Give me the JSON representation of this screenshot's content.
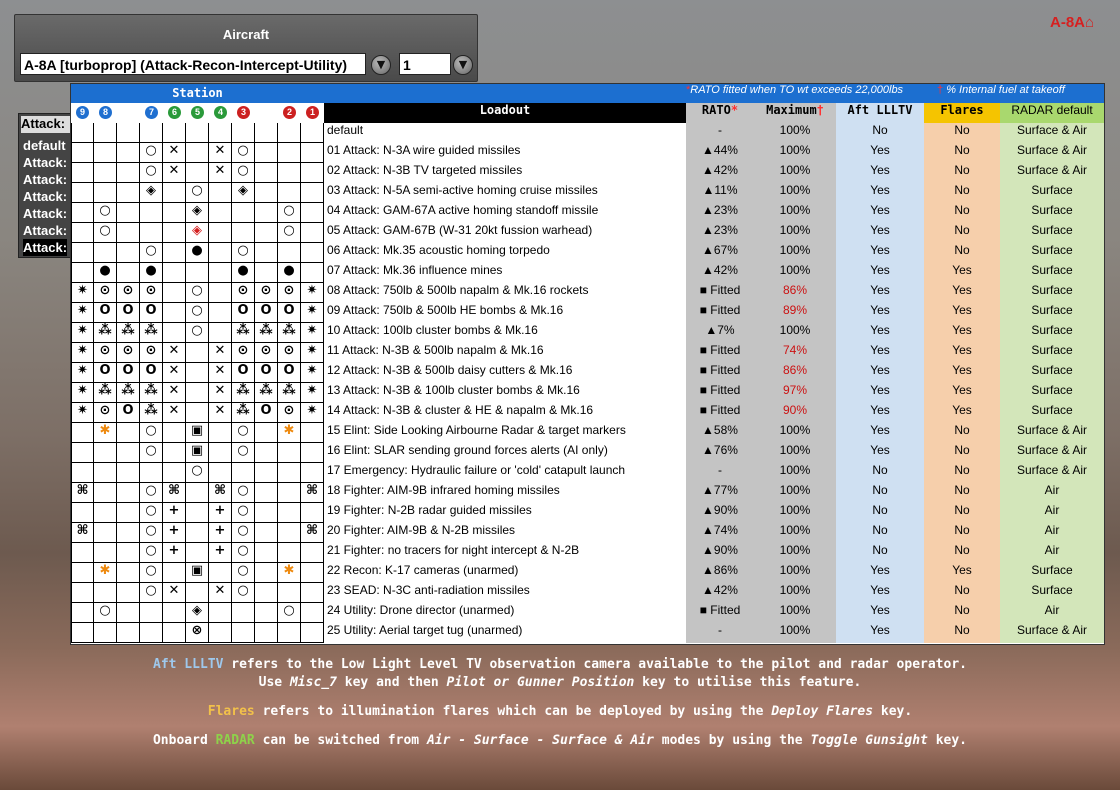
{
  "aircraft_panel": {
    "title": "Aircraft",
    "aircraft_value": "A-8A [turboprop] (Attack-Recon-Intercept-Utility)",
    "count_value": "1"
  },
  "corner_logo": "A-8A",
  "left_panel": {
    "tab": "Attack:",
    "items": [
      "default",
      "Attack:",
      "Attack:",
      "Attack:",
      "Attack:",
      "Attack:",
      "Attack:"
    ]
  },
  "table": {
    "station_title": "Station",
    "note_rato": "RATO fitted when TO wt exceeds 22,000lbs",
    "note_internal": "% Internal fuel at takeoff",
    "note_marks": [
      "*",
      "†"
    ],
    "station_numbers": [
      "9",
      "8",
      "",
      "7",
      "6",
      "5",
      "4",
      "3",
      "",
      "2",
      "1"
    ],
    "station_colors": [
      "#1f6fd0",
      "#1f6fd0",
      "",
      "#1f6fd0",
      "#2a9a3a",
      "#2a9a3a",
      "#2a9a3a",
      "#cc2020",
      "",
      "#cc2020",
      "#cc2020"
    ],
    "headers": {
      "loadout": "Loadout",
      "rato": "RATO",
      "rato_mark": "*",
      "maximum": "Maximum",
      "maximum_mark": "†",
      "lltv": "Aft LLLTV",
      "flares": "Flares",
      "radar": "RADAR default"
    },
    "header_colors": {
      "loadout": "#000000",
      "rato": "#c4c4c4",
      "maximum": "#c4c4c4",
      "lltv": "#cfe0f2",
      "flares": "#f5c400",
      "radar": "#a9d86e"
    },
    "rows": [
      {
        "st": [
          "",
          "",
          "",
          "",
          "",
          "",
          "",
          "",
          "",
          "",
          ""
        ],
        "name": "default",
        "rato": "-",
        "max": "100%",
        "lltv": "No",
        "flares": "No",
        "radar": "Surface & Air"
      },
      {
        "st": [
          "",
          "",
          "",
          "○",
          "✕",
          "",
          "✕",
          "○",
          "",
          "",
          ""
        ],
        "name": "01 Attack: N-3A wire guided missiles",
        "rato": "▲44%",
        "max": "100%",
        "lltv": "Yes",
        "flares": "No",
        "radar": "Surface & Air"
      },
      {
        "st": [
          "",
          "",
          "",
          "○",
          "✕",
          "",
          "✕",
          "○",
          "",
          "",
          ""
        ],
        "name": "02 Attack: N-3B TV targeted missiles",
        "rato": "▲42%",
        "max": "100%",
        "lltv": "Yes",
        "flares": "No",
        "radar": "Surface & Air"
      },
      {
        "st": [
          "",
          "",
          "",
          "◈",
          "",
          "○",
          "",
          "◈",
          "",
          "",
          ""
        ],
        "name": "03 Attack: N-5A semi-active homing cruise missiles",
        "rato": "▲11%",
        "max": "100%",
        "lltv": "Yes",
        "flares": "No",
        "radar": "Surface"
      },
      {
        "st": [
          "",
          "○",
          "",
          "",
          "",
          "◈",
          "",
          "",
          "",
          "○",
          ""
        ],
        "name": "04 Attack: GAM-67A active homing standoff missile",
        "rato": "▲23%",
        "max": "100%",
        "lltv": "Yes",
        "flares": "No",
        "radar": "Surface"
      },
      {
        "st": [
          "",
          "○",
          "",
          "",
          "",
          "◈",
          "",
          "",
          "",
          "○",
          ""
        ],
        "name": "05 Attack: GAM-67B (W-31 20kt fussion warhead)",
        "rato": "▲23%",
        "max": "100%",
        "lltv": "Yes",
        "flares": "No",
        "radar": "Surface"
      },
      {
        "st": [
          "",
          "",
          "",
          "○",
          "",
          "●",
          "",
          "○",
          "",
          "",
          ""
        ],
        "name": "06 Attack: Mk.35 acoustic homing torpedo",
        "rato": "▲67%",
        "max": "100%",
        "lltv": "Yes",
        "flares": "No",
        "radar": "Surface"
      },
      {
        "st": [
          "",
          "●",
          "",
          "●",
          "",
          "",
          "",
          "●",
          "",
          "●",
          ""
        ],
        "name": "07 Attack: Mk.36 influence mines",
        "rato": "▲42%",
        "max": "100%",
        "lltv": "Yes",
        "flares": "Yes",
        "radar": "Surface"
      },
      {
        "st": [
          "✷",
          "⊙",
          "⊙",
          "⊙",
          "",
          "○",
          "",
          "⊙",
          "⊙",
          "⊙",
          "✷"
        ],
        "name": "08 Attack: 750lb & 500lb napalm & Mk.16 rockets",
        "rato": "■ Fitted",
        "max": "86%",
        "lltv": "Yes",
        "flares": "Yes",
        "radar": "Surface"
      },
      {
        "st": [
          "✷",
          "O",
          "O",
          "O",
          "",
          "○",
          "",
          "O",
          "O",
          "O",
          "✷"
        ],
        "name": "09 Attack: 750lb & 500lb HE bombs & Mk.16",
        "rato": "■ Fitted",
        "max": "89%",
        "lltv": "Yes",
        "flares": "Yes",
        "radar": "Surface"
      },
      {
        "st": [
          "✷",
          "⁂",
          "⁂",
          "⁂",
          "",
          "○",
          "",
          "⁂",
          "⁂",
          "⁂",
          "✷"
        ],
        "name": "10 Attack: 100lb cluster bombs & Mk.16",
        "rato": "▲7%",
        "max": "100%",
        "lltv": "Yes",
        "flares": "Yes",
        "radar": "Surface"
      },
      {
        "st": [
          "✷",
          "⊙",
          "⊙",
          "⊙",
          "✕",
          "",
          "✕",
          "⊙",
          "⊙",
          "⊙",
          "✷"
        ],
        "name": "11 Attack: N-3B & 500lb napalm & Mk.16",
        "rato": "■ Fitted",
        "max": "74%",
        "lltv": "Yes",
        "flares": "Yes",
        "radar": "Surface"
      },
      {
        "st": [
          "✷",
          "O",
          "O",
          "O",
          "✕",
          "",
          "✕",
          "O",
          "O",
          "O",
          "✷"
        ],
        "name": "12 Attack: N-3B & 500lb daisy cutters & Mk.16",
        "rato": "■ Fitted",
        "max": "86%",
        "lltv": "Yes",
        "flares": "Yes",
        "radar": "Surface"
      },
      {
        "st": [
          "✷",
          "⁂",
          "⁂",
          "⁂",
          "✕",
          "",
          "✕",
          "⁂",
          "⁂",
          "⁂",
          "✷"
        ],
        "name": "13 Attack: N-3B & 100lb cluster bombs & Mk.16",
        "rato": "■ Fitted",
        "max": "97%",
        "lltv": "Yes",
        "flares": "Yes",
        "radar": "Surface"
      },
      {
        "st": [
          "✷",
          "⊙",
          "O",
          "⁂",
          "✕",
          "",
          "✕",
          "⁂",
          "O",
          "⊙",
          "✷"
        ],
        "name": "14 Attack: N-3B & cluster & HE & napalm & Mk.16",
        "rato": "■ Fitted",
        "max": "90%",
        "lltv": "Yes",
        "flares": "Yes",
        "radar": "Surface"
      },
      {
        "st": [
          "",
          "✱",
          "",
          "○",
          "",
          "▣",
          "",
          "○",
          "",
          "✱",
          ""
        ],
        "name": "15 Elint: Side Looking Airbourne Radar & target markers",
        "rato": "▲58%",
        "max": "100%",
        "lltv": "Yes",
        "flares": "No",
        "radar": "Surface & Air"
      },
      {
        "st": [
          "",
          "",
          "",
          "○",
          "",
          "▣",
          "",
          "○",
          "",
          "",
          ""
        ],
        "name": "16 Elint: SLAR sending ground forces alerts (AI only)",
        "rato": "▲76%",
        "max": "100%",
        "lltv": "Yes",
        "flares": "No",
        "radar": "Surface & Air"
      },
      {
        "st": [
          "",
          "",
          "",
          "",
          "",
          "○",
          "",
          "",
          "",
          "",
          ""
        ],
        "name": "17 Emergency: Hydraulic failure or 'cold' catapult launch",
        "rato": "-",
        "max": "100%",
        "lltv": "No",
        "flares": "No",
        "radar": "Surface & Air"
      },
      {
        "st": [
          "⌘",
          "",
          "",
          "○",
          "⌘",
          "",
          "⌘",
          "○",
          "",
          "",
          "⌘"
        ],
        "name": "18 Fighter: AIM-9B infrared homing missiles",
        "rato": "▲77%",
        "max": "100%",
        "lltv": "No",
        "flares": "No",
        "radar": "Air"
      },
      {
        "st": [
          "",
          "",
          "",
          "○",
          "+",
          "",
          "+",
          "○",
          "",
          "",
          ""
        ],
        "name": "19 Fighter: N-2B radar guided missiles",
        "rato": "▲90%",
        "max": "100%",
        "lltv": "No",
        "flares": "No",
        "radar": "Air"
      },
      {
        "st": [
          "⌘",
          "",
          "",
          "○",
          "+",
          "",
          "+",
          "○",
          "",
          "",
          "⌘"
        ],
        "name": "20 Fighter: AIM-9B & N-2B missiles",
        "rato": "▲74%",
        "max": "100%",
        "lltv": "No",
        "flares": "No",
        "radar": "Air"
      },
      {
        "st": [
          "",
          "",
          "",
          "○",
          "+",
          "",
          "+",
          "○",
          "",
          "",
          ""
        ],
        "name": "21 Fighter: no tracers for night intercept & N-2B",
        "rato": "▲90%",
        "max": "100%",
        "lltv": "No",
        "flares": "No",
        "radar": "Air"
      },
      {
        "st": [
          "",
          "✱",
          "",
          "○",
          "",
          "▣",
          "",
          "○",
          "",
          "✱",
          ""
        ],
        "name": "22 Recon: K-17 cameras (unarmed)",
        "rato": "▲86%",
        "max": "100%",
        "lltv": "Yes",
        "flares": "Yes",
        "radar": "Surface"
      },
      {
        "st": [
          "",
          "",
          "",
          "○",
          "✕",
          "",
          "✕",
          "○",
          "",
          "",
          ""
        ],
        "name": "23 SEAD: N-3C anti-radiation missiles",
        "rato": "▲42%",
        "max": "100%",
        "lltv": "Yes",
        "flares": "No",
        "radar": "Surface"
      },
      {
        "st": [
          "",
          "○",
          "",
          "",
          "",
          "◈",
          "",
          "",
          "",
          "○",
          ""
        ],
        "name": "24 Utility: Drone director (unarmed)",
        "rato": "■ Fitted",
        "max": "100%",
        "lltv": "Yes",
        "flares": "No",
        "radar": "Air"
      },
      {
        "st": [
          "",
          "",
          "",
          "",
          "",
          "⊗",
          "",
          "",
          "",
          "",
          ""
        ],
        "name": "25 Utility: Aerial target tug (unarmed)",
        "rato": "-",
        "max": "100%",
        "lltv": "Yes",
        "flares": "No",
        "radar": "Surface & Air"
      }
    ],
    "red_max_values": [
      "86%",
      "89%",
      "74%",
      "86%",
      "97%",
      "90%"
    ]
  },
  "footer": {
    "l1a": "Aft LLLTV",
    "l1b": " refers to the Low Light Level TV observation camera available to the pilot and radar operator.",
    "l2a": "Use ",
    "l2b": "Misc_7",
    "l2c": " key and then ",
    "l2d": "Pilot or Gunner Position",
    "l2e": " key to utilise this feature.",
    "l3a": "Flares",
    "l3b": " refers to illumination flares which can be deployed by using the ",
    "l3c": "Deploy Flares",
    "l3d": " key.",
    "l4a": "Onboard ",
    "l4b": "RADAR",
    "l4c": " can be switched from ",
    "l4d": "Air - Surface - Surface & Air",
    "l4e": " modes by using the ",
    "l4f": "Toggle Gunsight",
    "l4g": " key."
  }
}
